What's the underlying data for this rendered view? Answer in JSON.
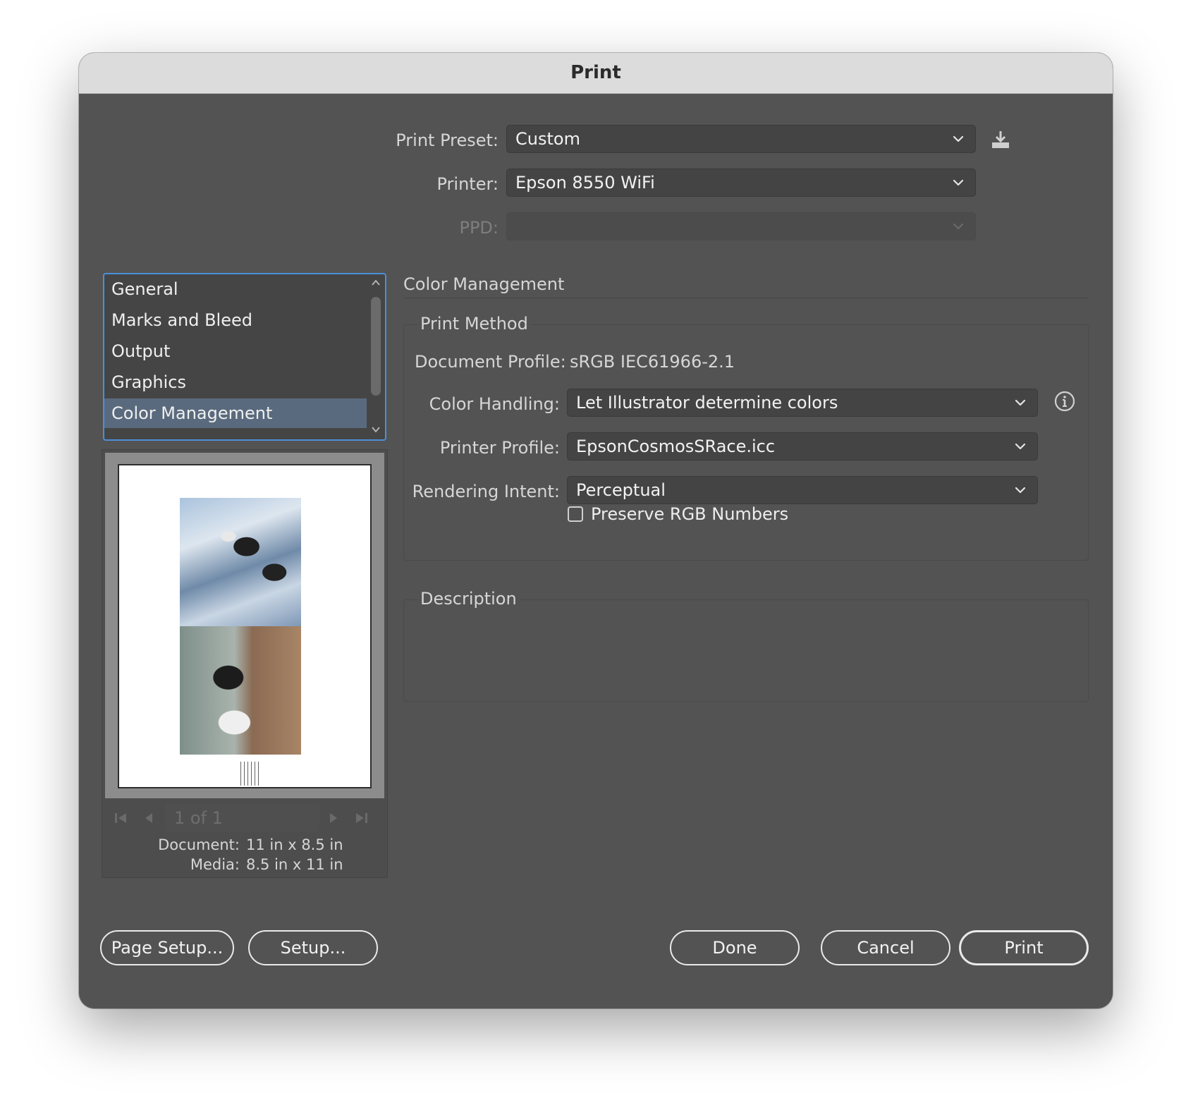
{
  "window": {
    "title": "Print"
  },
  "top": {
    "print_preset_label": "Print Preset:",
    "print_preset_value": "Custom",
    "printer_label": "Printer:",
    "printer_value": "Epson 8550 WiFi",
    "ppd_label": "PPD:",
    "ppd_value": ""
  },
  "sidebar": {
    "items": [
      {
        "label": "General"
      },
      {
        "label": "Marks and Bleed"
      },
      {
        "label": "Output"
      },
      {
        "label": "Graphics"
      },
      {
        "label": "Color Management",
        "selected": true
      }
    ]
  },
  "preview": {
    "page_indicator": "1 of 1",
    "document_label": "Document:",
    "document_value": "11 in x 8.5 in",
    "media_label": "Media:",
    "media_value": "8.5 in x 11 in"
  },
  "main": {
    "section_title": "Color Management",
    "print_method": {
      "title": "Print Method",
      "document_profile_label": "Document Profile:",
      "document_profile_value": "sRGB IEC61966-2.1",
      "color_handling_label": "Color Handling:",
      "color_handling_value": "Let Illustrator determine colors",
      "printer_profile_label": "Printer Profile:",
      "printer_profile_value": "EpsonCosmosSRace.icc",
      "rendering_intent_label": "Rendering Intent:",
      "rendering_intent_value": "Perceptual",
      "preserve_rgb_label": "Preserve RGB Numbers",
      "preserve_rgb_checked": false
    },
    "description": {
      "title": "Description",
      "text": ""
    }
  },
  "buttons": {
    "page_setup": "Page Setup...",
    "setup": "Setup...",
    "done": "Done",
    "cancel": "Cancel",
    "print": "Print"
  },
  "colors": {
    "dialog_bg": "#535353",
    "titlebar_bg": "#dcdcdc",
    "selection_bg": "#5a6a7e",
    "focus_ring": "#4a90d9"
  }
}
